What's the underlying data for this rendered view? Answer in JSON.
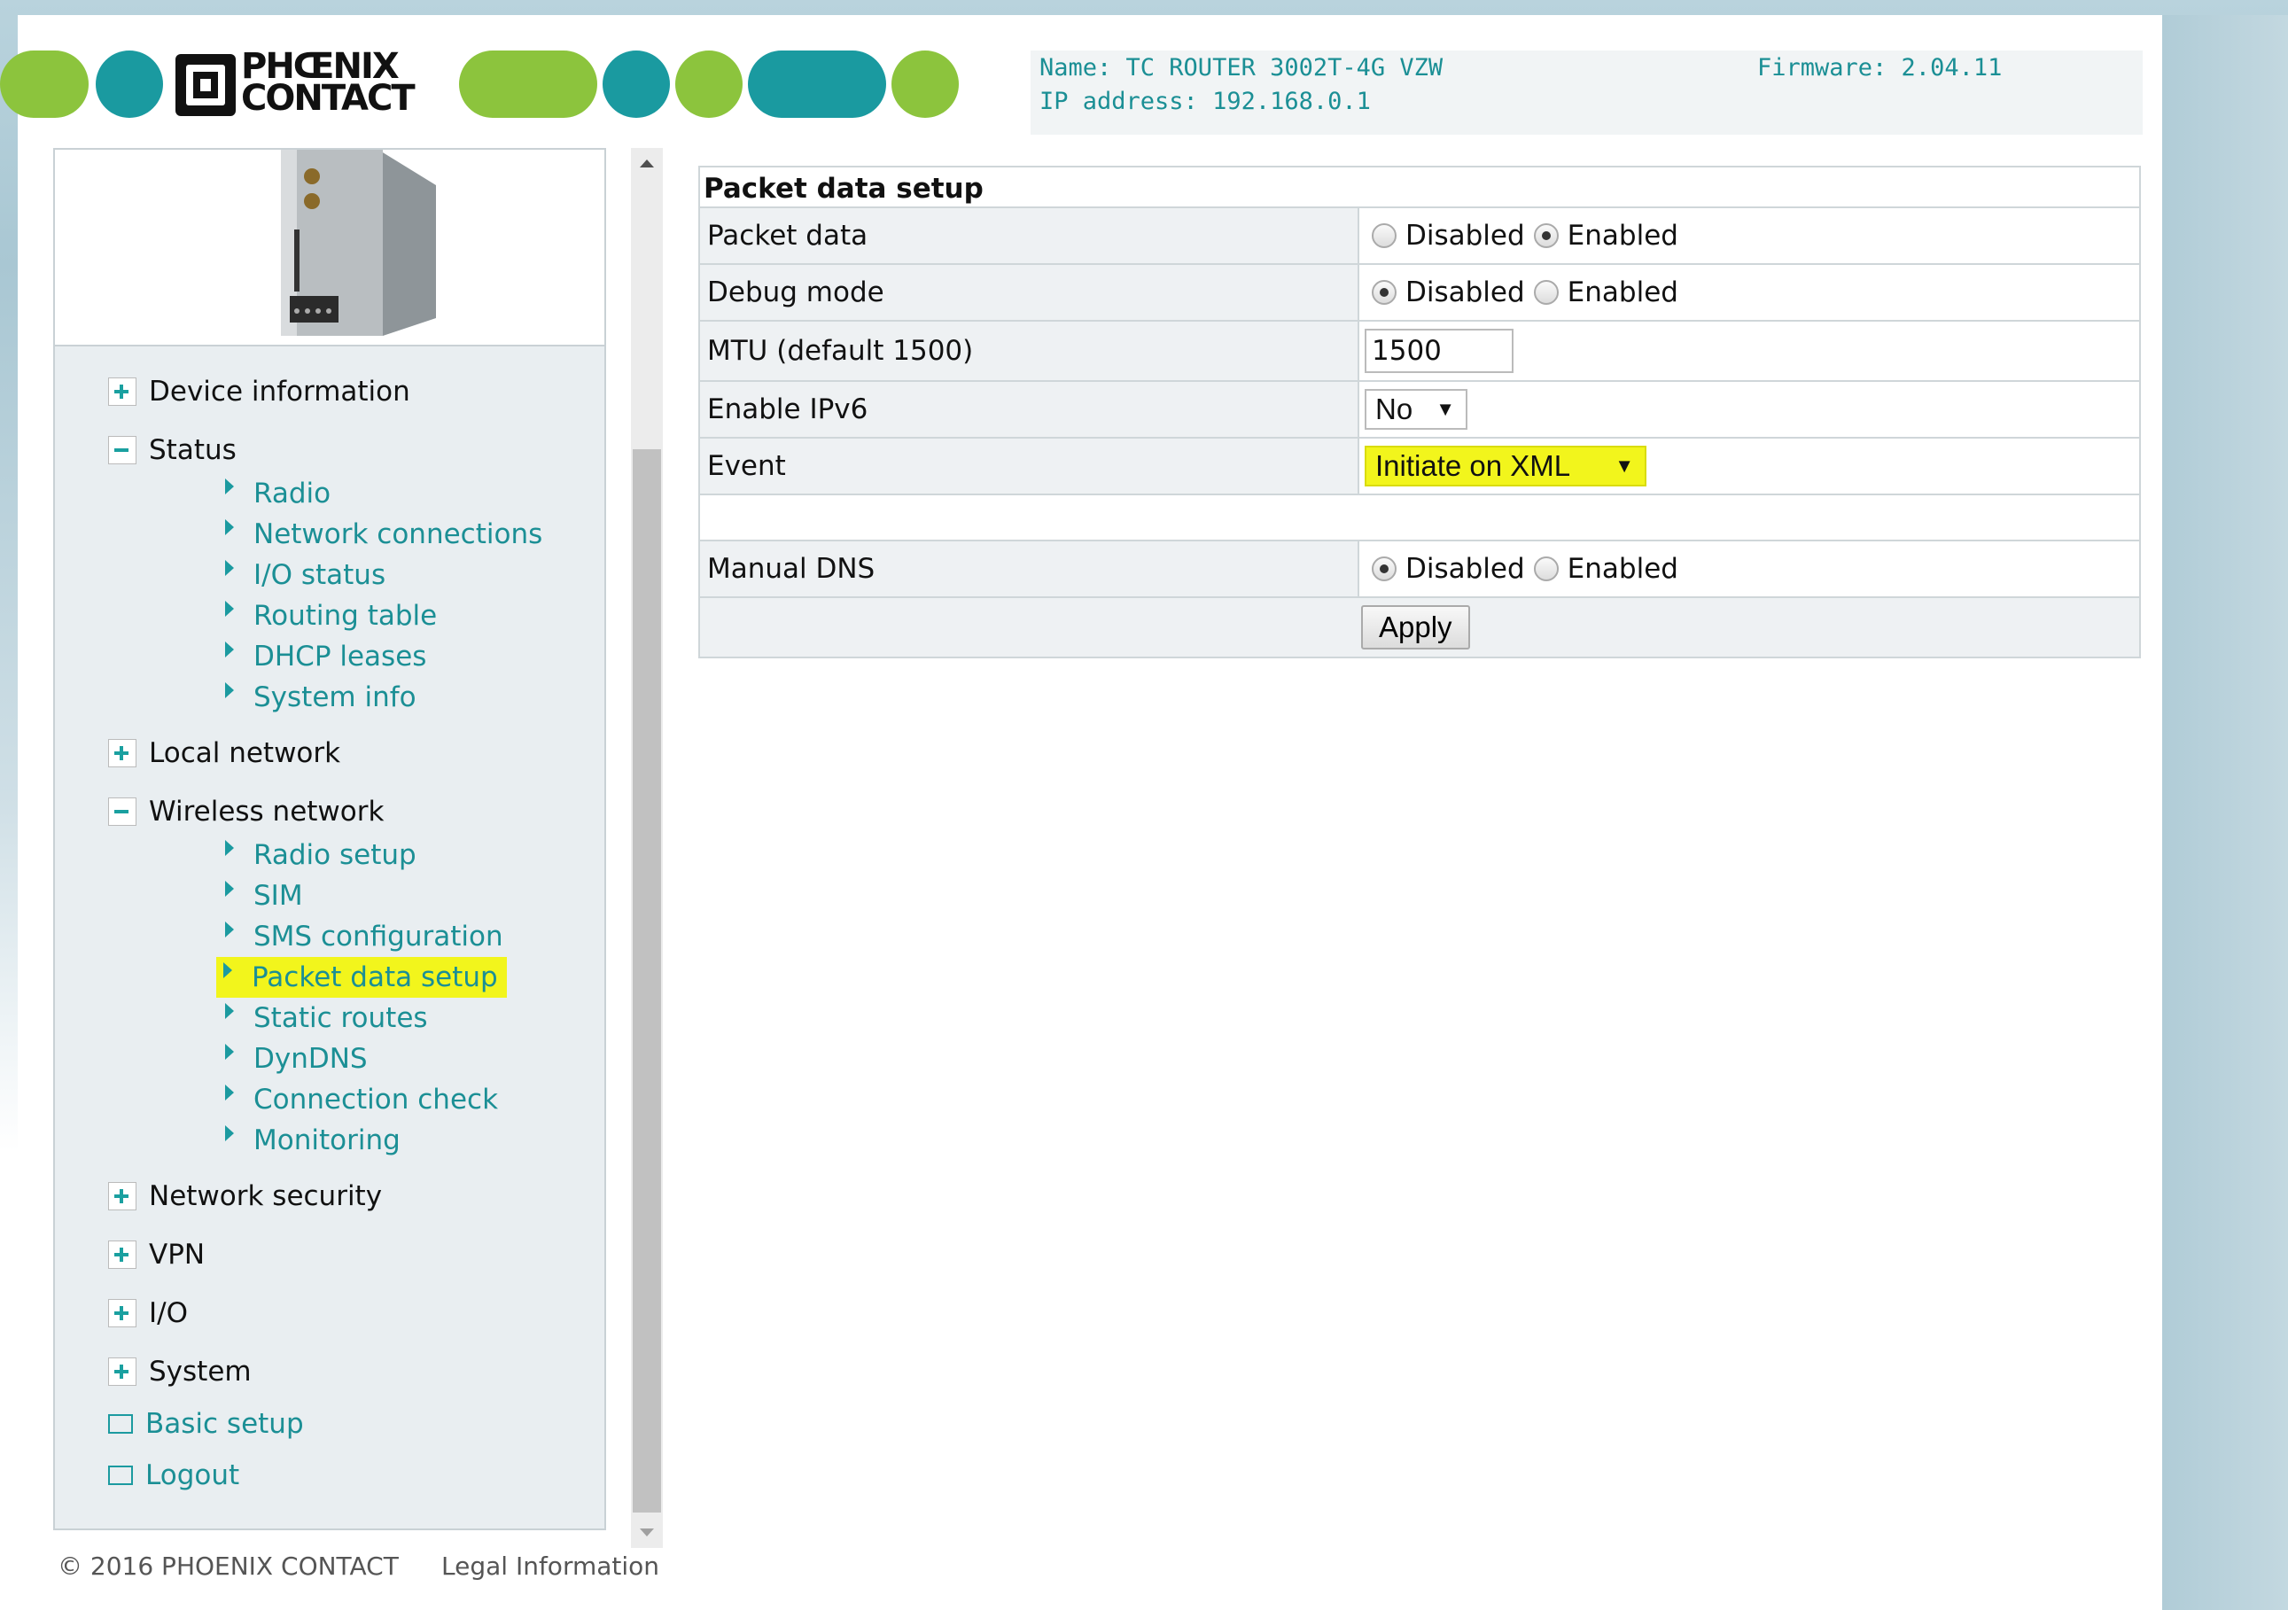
{
  "header": {
    "logo_line1": "PHŒNIX",
    "logo_line2": "CONTACT",
    "name": "Name: TC ROUTER 3002T-4G VZW",
    "ip": "IP address: 192.168.0.1",
    "firmware": "Firmware: 2.04.11"
  },
  "sidebar": {
    "device_information": "Device information",
    "status": "Status",
    "status_items": [
      "Radio",
      "Network connections",
      "I/O status",
      "Routing table",
      "DHCP leases",
      "System info"
    ],
    "local_network": "Local network",
    "wireless_network": "Wireless network",
    "wireless_items": [
      "Radio setup",
      "SIM",
      "SMS configuration",
      "Packet data setup",
      "Static routes",
      "DynDNS",
      "Connection check",
      "Monitoring"
    ],
    "network_security": "Network security",
    "vpn": "VPN",
    "io": "I/O",
    "system": "System",
    "basic_setup": "Basic setup",
    "logout": "Logout"
  },
  "footer": {
    "copyright": "© 2016 PHOENIX CONTACT",
    "legal": "Legal Information"
  },
  "form": {
    "title": "Packet data setup",
    "packet_data": {
      "label": "Packet data",
      "disabled": "Disabled",
      "enabled": "Enabled",
      "selected": "Enabled"
    },
    "debug_mode": {
      "label": "Debug mode",
      "disabled": "Disabled",
      "enabled": "Enabled",
      "selected": "Disabled"
    },
    "mtu": {
      "label": "MTU (default 1500)",
      "value": "1500"
    },
    "enable_ipv6": {
      "label": "Enable IPv6",
      "value": "No"
    },
    "event": {
      "label": "Event",
      "value": "Initiate on XML"
    },
    "manual_dns": {
      "label": "Manual DNS",
      "disabled": "Disabled",
      "enabled": "Enabled",
      "selected": "Disabled"
    },
    "apply": "Apply"
  },
  "colors": {
    "brand_green": "#8cc43d",
    "brand_teal": "#1a9aa0",
    "link": "#1b8f95",
    "highlight": "#f2f51c"
  },
  "icons": [
    "plus-icon",
    "minus-icon",
    "arrow-right-icon",
    "basic-setup-icon",
    "logout-icon",
    "scroll-up-icon",
    "scroll-down-icon",
    "dropdown-arrow-icon"
  ]
}
